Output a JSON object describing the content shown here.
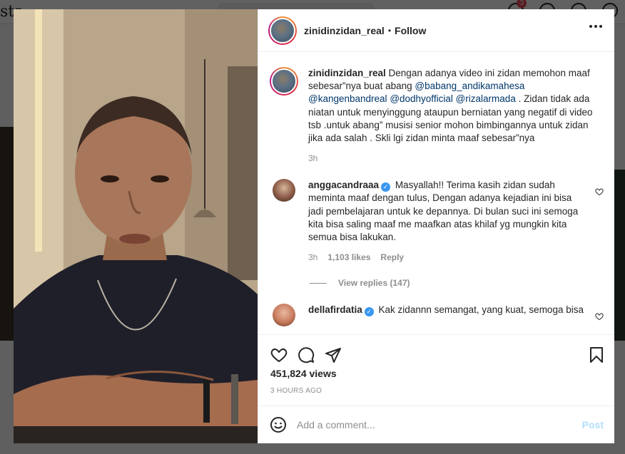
{
  "background": {
    "logo_fragment": "sta",
    "notification_count": "3"
  },
  "post": {
    "author": "zinidinzidan_real",
    "separator": "•",
    "follow_label": "Follow",
    "caption": {
      "author": "zinidinzidan_real",
      "text_parts": [
        "Dengan adanya video ini zidan memohon maaf sebesar”nya buat abang ",
        "@babang_andikamahesa",
        " ",
        "@kangenbandreal",
        " ",
        "@dodhyofficial",
        " ",
        "@rizalarmada",
        " . Zidan tidak ada niatan untuk menyinggung ataupun berniatan yang negatif di video tsb .untuk abang” musisi senior mohon bimbingannya untuk zidan jika ada salah . Skli lgi zidan minta maaf sebesar”nya"
      ],
      "time": "3h"
    },
    "comments": [
      {
        "author": "anggacandraaa",
        "verified": true,
        "text": "Masyallah!! Terima kasih zidan sudah meminta maaf dengan tulus, Dengan adanya kejadian ini bisa jadi pembelajaran untuk ke depannya. Di bulan suci ini semoga kita bisa saling maaf me maafkan atas khilaf yg mungkin kita semua bisa lakukan.",
        "time": "3h",
        "likes": "1,103 likes",
        "reply_label": "Reply",
        "view_replies": "View replies (147)"
      },
      {
        "author": "dellafirdatia",
        "verified": true,
        "text": "Kak zidannn semangat, yang kuat, semoga bisa"
      }
    ],
    "views": "451,824 views",
    "posted_time": "3 HOURS AGO",
    "add_comment_placeholder": "Add a comment...",
    "post_label": "Post"
  },
  "icons": {
    "more": "more-options-icon",
    "like": "heart-icon",
    "comment": "comment-bubble-icon",
    "share": "paper-plane-icon",
    "save": "bookmark-icon",
    "emoji": "emoji-smile-icon",
    "verified": "verified-badge-icon"
  },
  "colors": {
    "mention": "#00376b",
    "muted": "#8e8e8e",
    "post_disabled": "#b2dffc",
    "verified": "#3897f0"
  }
}
